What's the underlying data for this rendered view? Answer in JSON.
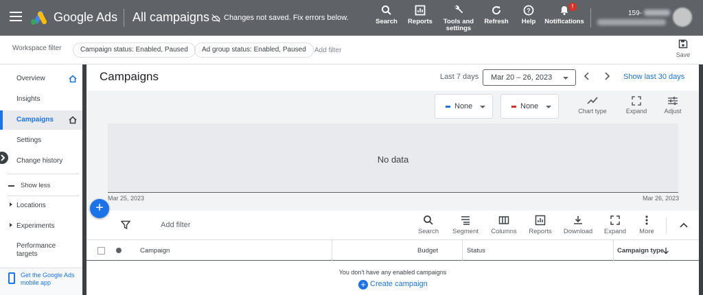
{
  "header": {
    "brand": "Google Ads",
    "page_title": "All campaigns",
    "unsaved_message": "Changes not saved. Fix errors below.",
    "tools": [
      {
        "label": "Search",
        "icon": "search-icon"
      },
      {
        "label": "Reports",
        "icon": "reports-icon"
      },
      {
        "label": "Tools and settings",
        "icon": "wrench-icon"
      },
      {
        "label": "Refresh",
        "icon": "refresh-icon"
      },
      {
        "label": "Help",
        "icon": "help-icon"
      },
      {
        "label": "Notifications",
        "icon": "bell-icon"
      }
    ],
    "notification_badge": "!",
    "account_id": "159-"
  },
  "filters": {
    "workspace_label": "Workspace filter",
    "chips": [
      "Campaign status: Enabled, Paused",
      "Ad group status: Enabled, Paused"
    ],
    "add_filter": "Add filter",
    "save_label": "Save"
  },
  "sidebar": {
    "items": [
      {
        "label": "Overview",
        "home": true
      },
      {
        "label": "Insights"
      },
      {
        "label": "Campaigns",
        "active": true,
        "home": true
      },
      {
        "label": "Settings"
      },
      {
        "label": "Change history"
      }
    ],
    "show_less": "Show less",
    "groups": [
      "Locations",
      "Experiments"
    ],
    "extra": "Performance targets",
    "mobile_app": "Get the Google Ads mobile app"
  },
  "main": {
    "title": "Campaigns",
    "period_label": "Last 7 days",
    "date_range": "Mar 20 – 26, 2023",
    "show_last": "Show last 30 days",
    "metric1": "None",
    "metric2": "None",
    "chart_tools": [
      "Chart type",
      "Expand",
      "Adjust"
    ],
    "no_data": "No data",
    "x_start": "Mar 25, 2023",
    "x_end": "Mar 26, 2023"
  },
  "table": {
    "add_filter": "Add filter",
    "tools": [
      "Search",
      "Segment",
      "Columns",
      "Reports",
      "Download",
      "Expand",
      "More"
    ],
    "columns": [
      "Campaign",
      "Budget",
      "Status",
      "Campaign type"
    ],
    "empty_message": "You don't have any enabled campaigns",
    "create_label": "Create campaign"
  },
  "colors": {
    "topbar": "#5f6368",
    "accent": "#1a73e8",
    "metric1": "#1a73e8",
    "metric2": "#d93025"
  }
}
